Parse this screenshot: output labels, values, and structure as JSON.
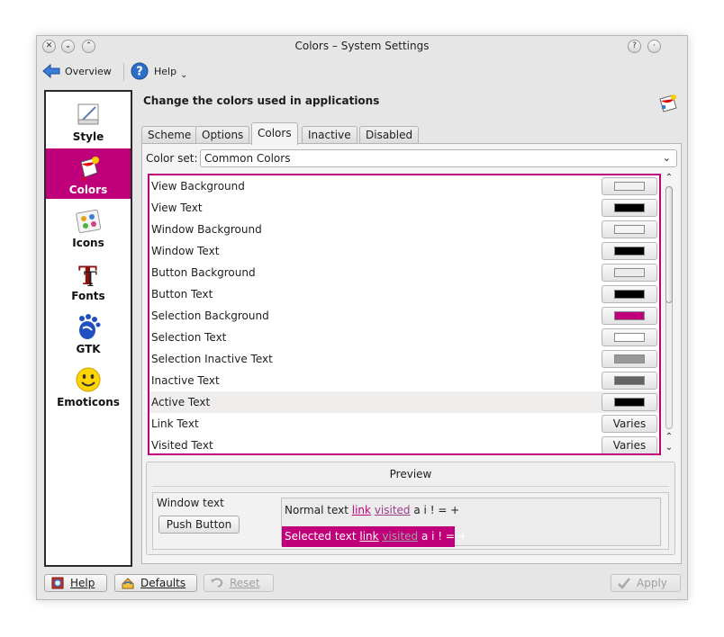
{
  "window": {
    "title": "Colors – System Settings"
  },
  "toolbar": {
    "overview_label": "Overview",
    "help_label": "Help"
  },
  "sidebar": {
    "items": [
      {
        "label": "Style",
        "active": false
      },
      {
        "label": "Colors",
        "active": true
      },
      {
        "label": "Icons",
        "active": false
      },
      {
        "label": "Fonts",
        "active": false
      },
      {
        "label": "GTK",
        "active": false
      },
      {
        "label": "Emoticons",
        "active": false
      }
    ]
  },
  "main": {
    "heading": "Change the colors used in applications",
    "tabs": [
      {
        "label": "Scheme",
        "active": false
      },
      {
        "label": "Options",
        "active": false
      },
      {
        "label": "Colors",
        "active": true
      },
      {
        "label": "Inactive",
        "active": false
      },
      {
        "label": "Disabled",
        "active": false
      }
    ],
    "color_set_label": "Color set:",
    "color_set_value": "Common Colors",
    "color_rows": [
      {
        "name": "View Background",
        "color": "#f2f2f2"
      },
      {
        "name": "View Text",
        "color": "#000000"
      },
      {
        "name": "Window Background",
        "color": "#f4f4f4"
      },
      {
        "name": "Window Text",
        "color": "#000000"
      },
      {
        "name": "Button Background",
        "color": "#ececec"
      },
      {
        "name": "Button Text",
        "color": "#000000"
      },
      {
        "name": "Selection Background",
        "color": "#c0007a"
      },
      {
        "name": "Selection Text",
        "color": "#ffffff"
      },
      {
        "name": "Selection Inactive Text",
        "color": "#989898"
      },
      {
        "name": "Inactive Text",
        "color": "#646464"
      },
      {
        "name": "Active Text",
        "color": "#000000"
      },
      {
        "name": "Link Text",
        "varies": "Varies"
      },
      {
        "name": "Visited Text",
        "varies": "Varies"
      }
    ],
    "preview": {
      "title": "Preview",
      "window_text": "Window text",
      "push_button": "Push Button",
      "normal_text": "Normal text",
      "selected_text": "Selected text",
      "link": "link",
      "visited": "visited",
      "tail": "a i ! = +"
    }
  },
  "bottom": {
    "help_label": "Help",
    "defaults_label": "Defaults",
    "reset_label": "Reset",
    "apply_label": "Apply"
  },
  "colors": {
    "accent": "#c0007a"
  }
}
